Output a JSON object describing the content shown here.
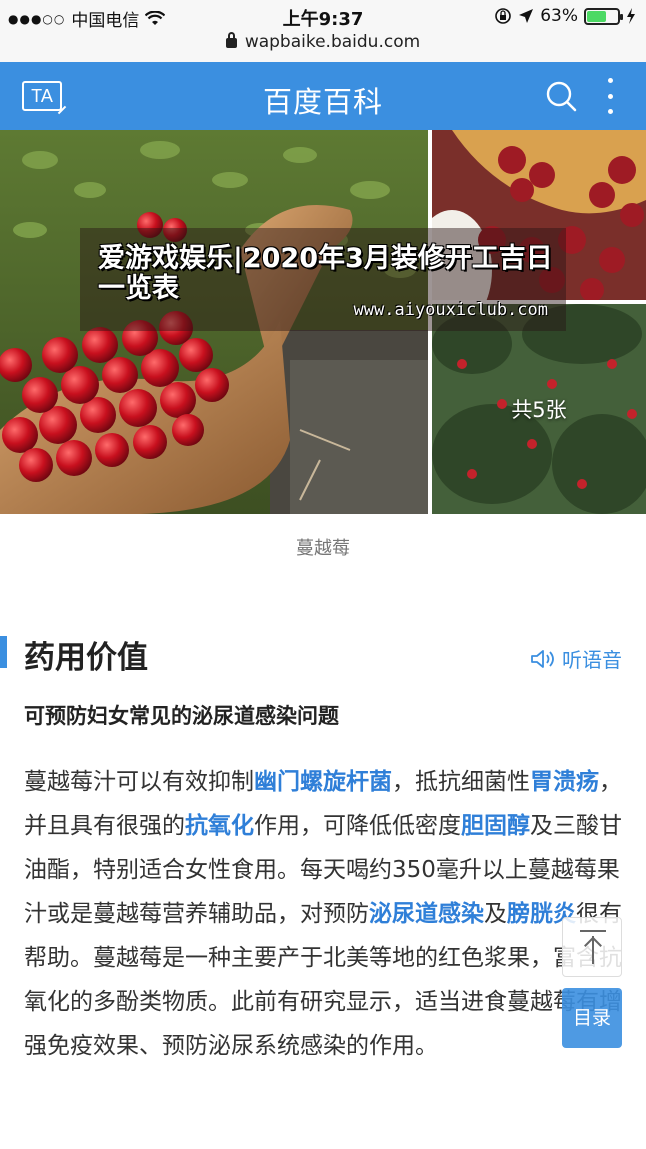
{
  "status_bar": {
    "signal": "●●●○○",
    "carrier": "中国电信",
    "time": "上午9:37",
    "battery_percent": "63%",
    "battery_level": 0.63
  },
  "url_bar": {
    "domain": "wapbaike.baidu.com"
  },
  "header": {
    "ta_label": "TA",
    "title": "百度百科"
  },
  "gallery": {
    "photo_count": "共5张",
    "caption": "蔓越莓"
  },
  "watermark": {
    "title": "爱游戏娱乐|2020年3月装修开工吉日一览表",
    "url": "www.aiyouxiclub.com"
  },
  "section": {
    "title": "药用价值",
    "listen_label": "听语音",
    "subheading": "可预防妇女常见的泌尿道感染问题"
  },
  "article": {
    "p1": "蔓越莓汁可以有效抑制",
    "link1": "幽门螺旋杆菌",
    "p2": "，抵抗细菌性",
    "link2": "胃溃疡",
    "p3": "，并且具有很强的",
    "link3": "抗氧化",
    "p4": "作用，可降低低密度",
    "link4": "胆固醇",
    "p5": "及三酸甘油酯，特别适合女性食用。每天喝约350毫升以上蔓越莓果汁或是蔓越莓营养辅助品，对预防",
    "link5": "泌尿道感染",
    "p6": "及",
    "link6": "膀胱炎",
    "p7": "很有帮助。蔓越莓是一种主要产于北美等地的红色浆果，富含抗氧化的多酚类物质。此前有研究显示，适当进食蔓越莓有增强免疫效果、预防泌尿系统感染的作用。"
  },
  "floating": {
    "toc_label": "目录"
  },
  "colors": {
    "brand_blue": "#3b8fe0",
    "link_blue": "#2f7fd8"
  }
}
